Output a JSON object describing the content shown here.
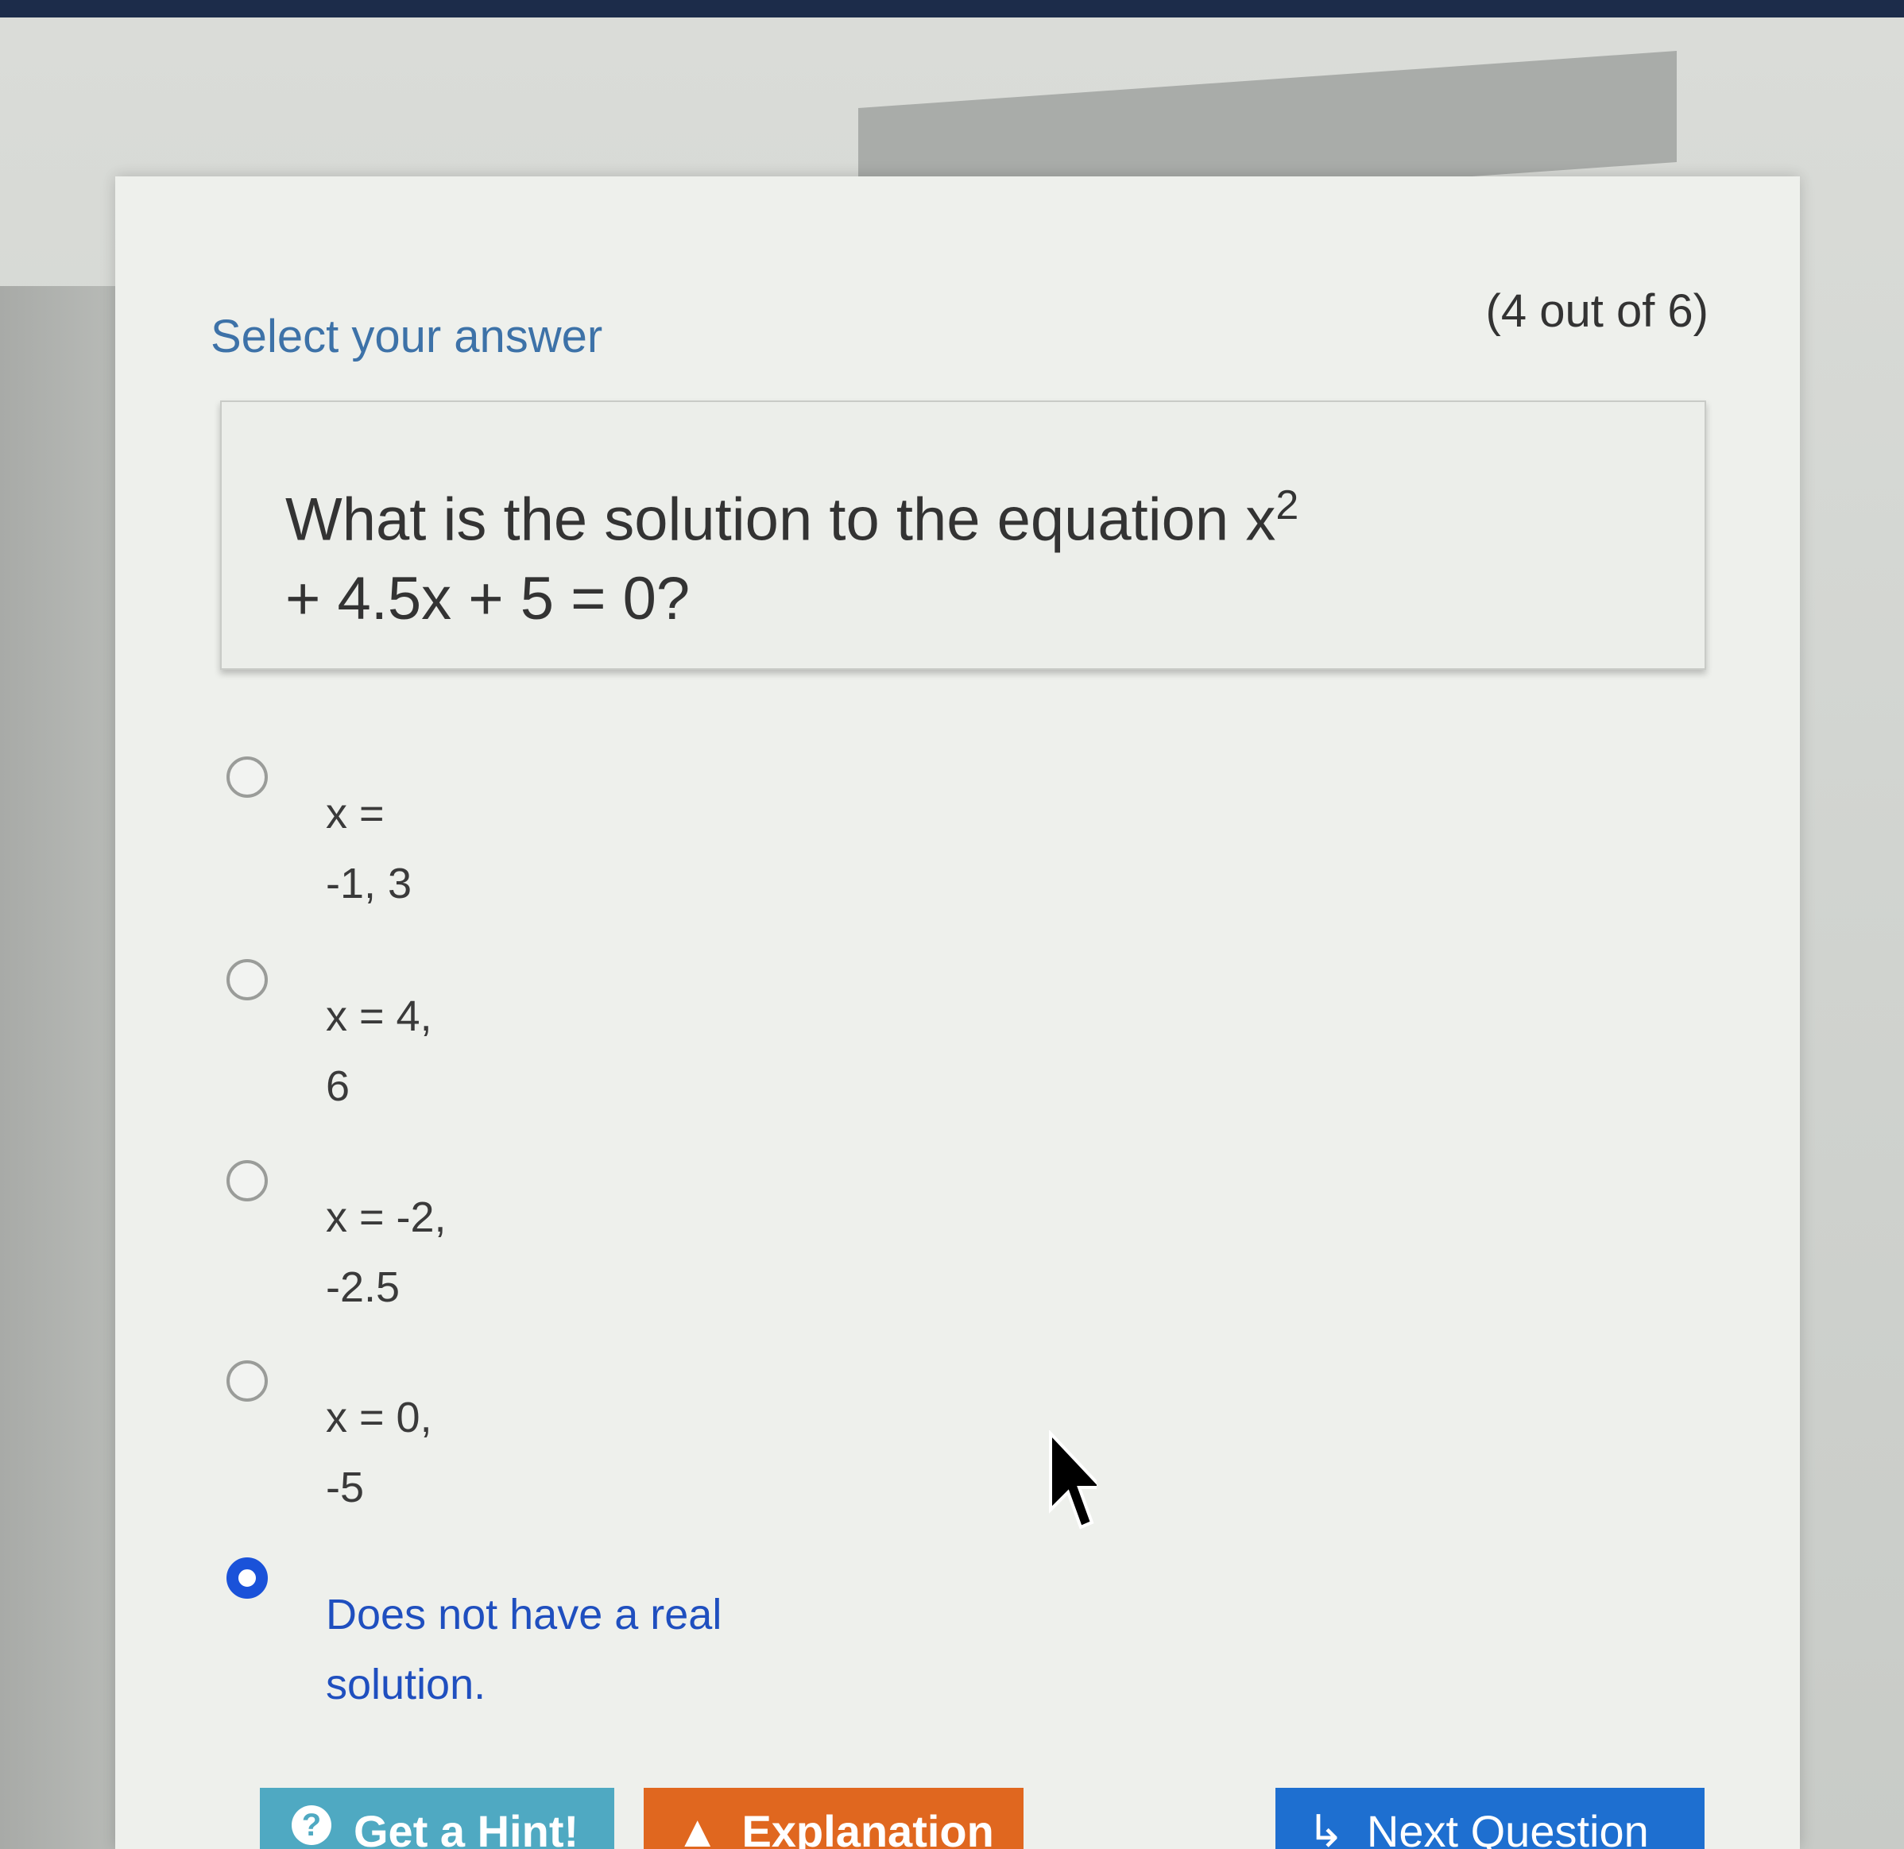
{
  "quiz": {
    "heading": "Select your answer",
    "counter": "(4 out of 6)",
    "question": {
      "line1": "What is the solution to the equation x",
      "exponent": "2",
      "line2": "+ 4.5x + 5 = 0?"
    },
    "options": [
      {
        "line1": "x =",
        "line2": "-1, 3",
        "selected": false
      },
      {
        "line1": "x = 4,",
        "line2": "6",
        "selected": false
      },
      {
        "line1": "x = -2,",
        "line2": "-2.5",
        "selected": false
      },
      {
        "line1": "x = 0,",
        "line2": "-5",
        "selected": false
      },
      {
        "line1": "Does not have a real",
        "line2": "solution.",
        "selected": true
      }
    ]
  },
  "buttons": {
    "hint": {
      "label": "Get a Hint!",
      "icon": "question-circle-icon"
    },
    "explanation": {
      "label": "Explanation",
      "icon": "warning-triangle-icon"
    },
    "next": {
      "label": "Next Question",
      "icon": "return-arrow-icon"
    }
  },
  "colors": {
    "heading": "#3d72a8",
    "selected": "#1a52d9",
    "hint_button": "#4fa9c2",
    "explanation_button": "#e0671f",
    "next_button": "#1e6fd0"
  }
}
